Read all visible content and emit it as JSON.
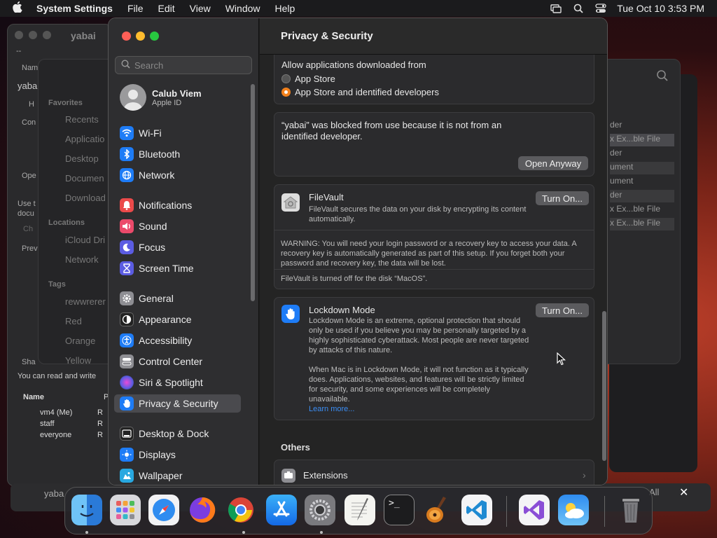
{
  "menubar": {
    "app_name": "System Settings",
    "menus": [
      "File",
      "Edit",
      "View",
      "Window",
      "Help"
    ],
    "clock": "Tue Oct 10  3:53 PM"
  },
  "background": {
    "window1_title": "yabai",
    "window1_rows": [
      "--",
      "Nam",
      "yaba",
      "H",
      "Con",
      "Ope",
      "Use t",
      "docu",
      "Ch",
      "Prev",
      "Sha",
      "You can read and write"
    ],
    "sharing_header": [
      "Name",
      "P"
    ],
    "sharing_rows": [
      {
        "name": "vm4 (Me)",
        "perm": "R"
      },
      {
        "name": "staff",
        "perm": "R"
      },
      {
        "name": "everyone",
        "perm": "R"
      }
    ],
    "finder_sections": [
      "Favorites",
      "Locations",
      "Tags"
    ],
    "finder_items": [
      "Recents",
      "Applicatio",
      "Desktop",
      "Documen",
      "Download",
      "iCloud Dri",
      "Network",
      "rewwrerer",
      "Red",
      "Orange",
      "Yellow"
    ],
    "right_items": [
      "der",
      "x Ex...ble File",
      "der",
      "ument",
      "ument",
      "der",
      "x Ex...ble File",
      "x Ex...ble File"
    ],
    "bottom_label": "yaba",
    "bottom_right": "All"
  },
  "sidebar": {
    "search_placeholder": "Search",
    "profile": {
      "name": "Calub Viem",
      "sub": "Apple ID"
    },
    "items": [
      {
        "label": "Wi-Fi",
        "icon": "wifi-icon",
        "color": "#1e7cf6"
      },
      {
        "label": "Bluetooth",
        "icon": "bluetooth-icon",
        "color": "#1e7cf6"
      },
      {
        "label": "Network",
        "icon": "globe-icon",
        "color": "#1e7cf6"
      },
      {
        "label": "Notifications",
        "icon": "bell-icon",
        "color": "#eb4a4a"
      },
      {
        "label": "Sound",
        "icon": "speaker-icon",
        "color": "#eb4a6a"
      },
      {
        "label": "Focus",
        "icon": "moon-icon",
        "color": "#5b5ce2"
      },
      {
        "label": "Screen Time",
        "icon": "hourglass-icon",
        "color": "#5b5ce2"
      },
      {
        "label": "General",
        "icon": "gear-icon",
        "color": "#8e8e93"
      },
      {
        "label": "Appearance",
        "icon": "appearance-icon",
        "color": "#222222"
      },
      {
        "label": "Accessibility",
        "icon": "accessibility-icon",
        "color": "#1e7cf6"
      },
      {
        "label": "Control Center",
        "icon": "toggles-icon",
        "color": "#8e8e93"
      },
      {
        "label": "Siri & Spotlight",
        "icon": "siri-icon",
        "color": "#b04ad8"
      },
      {
        "label": "Privacy & Security",
        "icon": "hand-icon",
        "color": "#1e7cf6"
      },
      {
        "label": "Desktop & Dock",
        "icon": "dock-icon",
        "color": "#222222"
      },
      {
        "label": "Displays",
        "icon": "sun-icon",
        "color": "#1e7cf6"
      },
      {
        "label": "Wallpaper",
        "icon": "wallpaper-icon",
        "color": "#28a8e0"
      }
    ]
  },
  "content": {
    "title": "Privacy & Security",
    "allow_heading": "Allow applications downloaded from",
    "radio_options": [
      {
        "label": "App Store",
        "selected": false
      },
      {
        "label": "App Store and identified developers",
        "selected": true
      }
    ],
    "blocked_message": "“yabai” was blocked from use because it is not from an identified developer.",
    "open_anyway": "Open Anyway",
    "filevault": {
      "title": "FileVault",
      "desc": "FileVault secures the data on your disk by encrypting its content automatically.",
      "button": "Turn On...",
      "warning": "WARNING: You will need your login password or a recovery key to access your data. A recovery key is automatically generated as part of this setup. If you forget both your password and recovery key, the data will be lost.",
      "status": "FileVault is turned off for the disk “MacOS”."
    },
    "lockdown": {
      "title": "Lockdown Mode",
      "button": "Turn On...",
      "desc": "Lockdown Mode is an extreme, optional protection that should only be used if you believe you may be personally targeted by a highly sophisticated cyberattack. Most people are never targeted by attacks of this nature.",
      "desc2": "When Mac is in Lockdown Mode, it will not function as it typically does. Applications, websites, and features will be strictly limited for security, and some experiences will be completely unavailable.",
      "learn_more": "Learn more..."
    },
    "others_heading": "Others",
    "extensions": "Extensions"
  },
  "dock": {
    "apps": [
      "finder-icon",
      "launchpad-icon",
      "safari-icon",
      "firefox-icon",
      "chrome-icon",
      "app-store-icon",
      "system-settings-icon",
      "textedit-icon",
      "terminal-icon",
      "garageband-icon",
      "vscode-icon",
      "visual-studio-icon",
      "weather-icon",
      "trash-icon"
    ]
  }
}
